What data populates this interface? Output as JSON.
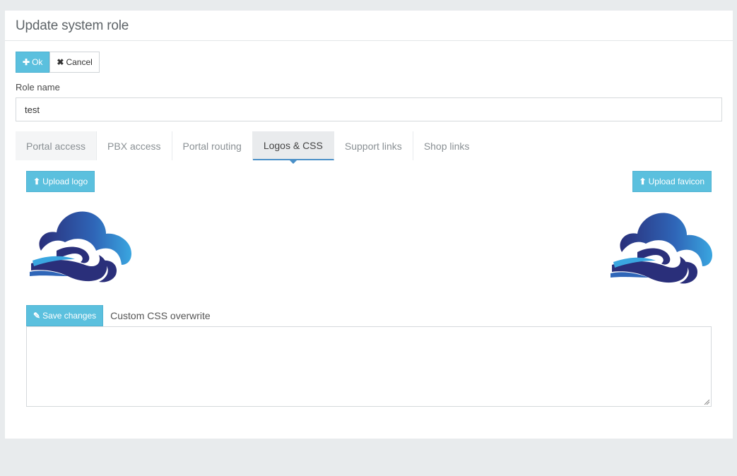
{
  "page": {
    "title": "Update system role"
  },
  "toolbar": {
    "ok_label": "Ok",
    "cancel_label": "Cancel"
  },
  "form": {
    "role_name_label": "Role name",
    "role_name_value": "test"
  },
  "tabs": [
    {
      "label": "Portal access"
    },
    {
      "label": "PBX access"
    },
    {
      "label": "Portal routing"
    },
    {
      "label": "Logos & CSS"
    },
    {
      "label": "Support links"
    },
    {
      "label": "Shop links"
    }
  ],
  "active_tab": "Logos & CSS",
  "logos": {
    "upload_logo_label": "Upload logo",
    "upload_favicon_label": "Upload favicon"
  },
  "css": {
    "save_label": "Save changes",
    "title": "Custom CSS overwrite",
    "value": ""
  },
  "colors": {
    "accent": "#5bc0de",
    "tab_underline": "#4a90c8",
    "logo_dark": "#2a2f7a",
    "logo_light": "#3aa6e0"
  },
  "icons": {
    "ok": "plus-icon",
    "cancel": "times-icon",
    "upload": "upload-icon",
    "save": "edit-icon"
  }
}
